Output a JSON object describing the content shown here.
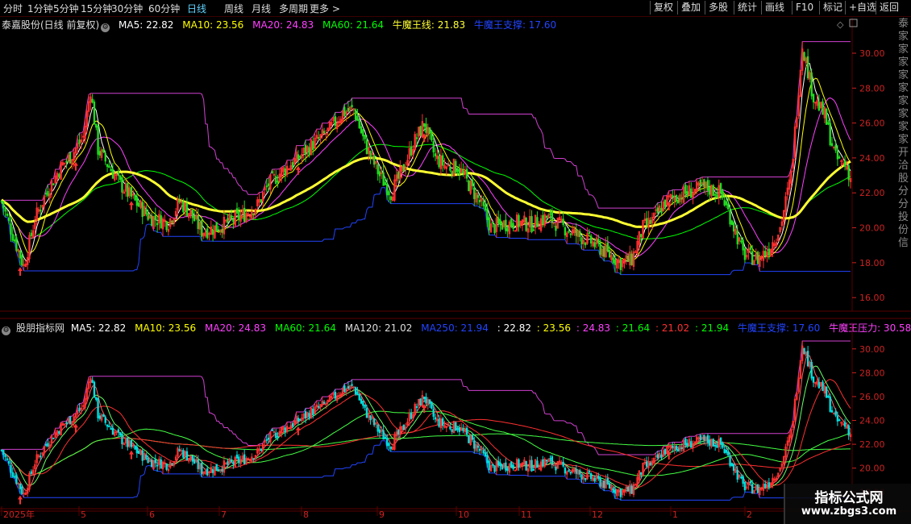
{
  "toolbar": {
    "periods": [
      "分时",
      "1分钟",
      "5分钟",
      "15分钟",
      "30分钟",
      "60分钟",
      "日线",
      "周线",
      "月线",
      "多周期",
      "更多 >"
    ],
    "active_period": "日线",
    "right_buttons": [
      "复权",
      "叠加",
      "多股",
      "统计",
      "画线",
      "F10",
      "标记",
      "+自选",
      "返回"
    ]
  },
  "main_panel": {
    "title": "泰嘉股份(日线 前复权)",
    "ma5": "MA5: 22.82",
    "ma10": "MA10: 23.56",
    "ma20": "MA20: 24.83",
    "ma60": "MA60: 21.64",
    "niu_line": "牛魔王线: 21.83",
    "niu_support": "牛魔王支撑: 17.60",
    "y_ticks": [
      "30.00",
      "28.00",
      "26.00",
      "24.00",
      "22.00",
      "20.00",
      "18.00",
      "16.00"
    ]
  },
  "sub_panel": {
    "title": "股朋指标网",
    "ma5": "MA5: 22.82",
    "ma10": "MA10: 23.56",
    "ma20": "MA20: 24.83",
    "ma60": "MA60: 21.64",
    "ma120": "MA120: 21.02",
    "ma250": "MA250: 21.94",
    "v1": ": 22.82",
    "v2": ": 23.56",
    "v3": ": 24.83",
    "v4": ": 21.64",
    "v5": ": 21.02",
    "v6": ": 21.94",
    "niu_support": "牛魔王支撑: 17.60",
    "niu_pressure": "牛魔王压力: 30.58",
    "y_ticks": [
      "30.00",
      "28.00",
      "26.00",
      "24.00",
      "22.00",
      "20.00",
      "18.00"
    ],
    "x_labels": [
      "2025年",
      "5",
      "6",
      "7",
      "8",
      "9",
      "10",
      "11",
      "12",
      "1",
      "2"
    ]
  },
  "right_strip_text": "泰家家家家家家家家家开洽股分分投份信",
  "watermark": {
    "line1": "指标公式网",
    "line2": "www.zbgs3.com"
  },
  "colors": {
    "up": "#ff3030",
    "down": "#00e0e0",
    "down_main": "#22dd22",
    "ma5": "#ffffff",
    "ma10": "#ffff00",
    "ma20": "#ff40ff",
    "ma60": "#00ff00",
    "niu_line": "#ffff33",
    "niu_support": "#2244ff",
    "niu_pressure": "#d040d0",
    "grid": "#5a0000",
    "axis_text": "#cc2222"
  },
  "chart_data": {
    "type": "candlestick",
    "title": "泰嘉股份(日线 前复权)",
    "period": "daily",
    "y_range_main": [
      15.5,
      31.2
    ],
    "y_range_sub": [
      16.8,
      31.0
    ],
    "approx_close_by_month": {
      "2025年4月": [
        21.5,
        18.0,
        20.5,
        22.0
      ],
      "5月": [
        23.5,
        27.9,
        24.0,
        23.0
      ],
      "6月": [
        21.5,
        20.5,
        21.5,
        20.0
      ],
      "7月": [
        19.8,
        20.3,
        21.0,
        22.5
      ],
      "8月": [
        24.0,
        25.5,
        27.0
      ],
      "9月": [
        24.5,
        22.0,
        26.0
      ],
      "10月": [
        23.0,
        20.0,
        20.3
      ],
      "11月": [
        20.5,
        19.5
      ],
      "12月": [
        18.5,
        17.8,
        20.5
      ],
      "1月": [
        21.0,
        22.5,
        22.0
      ],
      "2月": [
        18.5,
        20.0,
        30.5,
        27.0,
        22.8
      ]
    },
    "last_values": {
      "MA5": 22.82,
      "MA10": 23.56,
      "MA20": 24.83,
      "MA60": 21.64,
      "MA120": 21.02,
      "MA250": 21.94,
      "support": 17.6,
      "pressure": 30.58,
      "niu_line": 21.83
    }
  }
}
